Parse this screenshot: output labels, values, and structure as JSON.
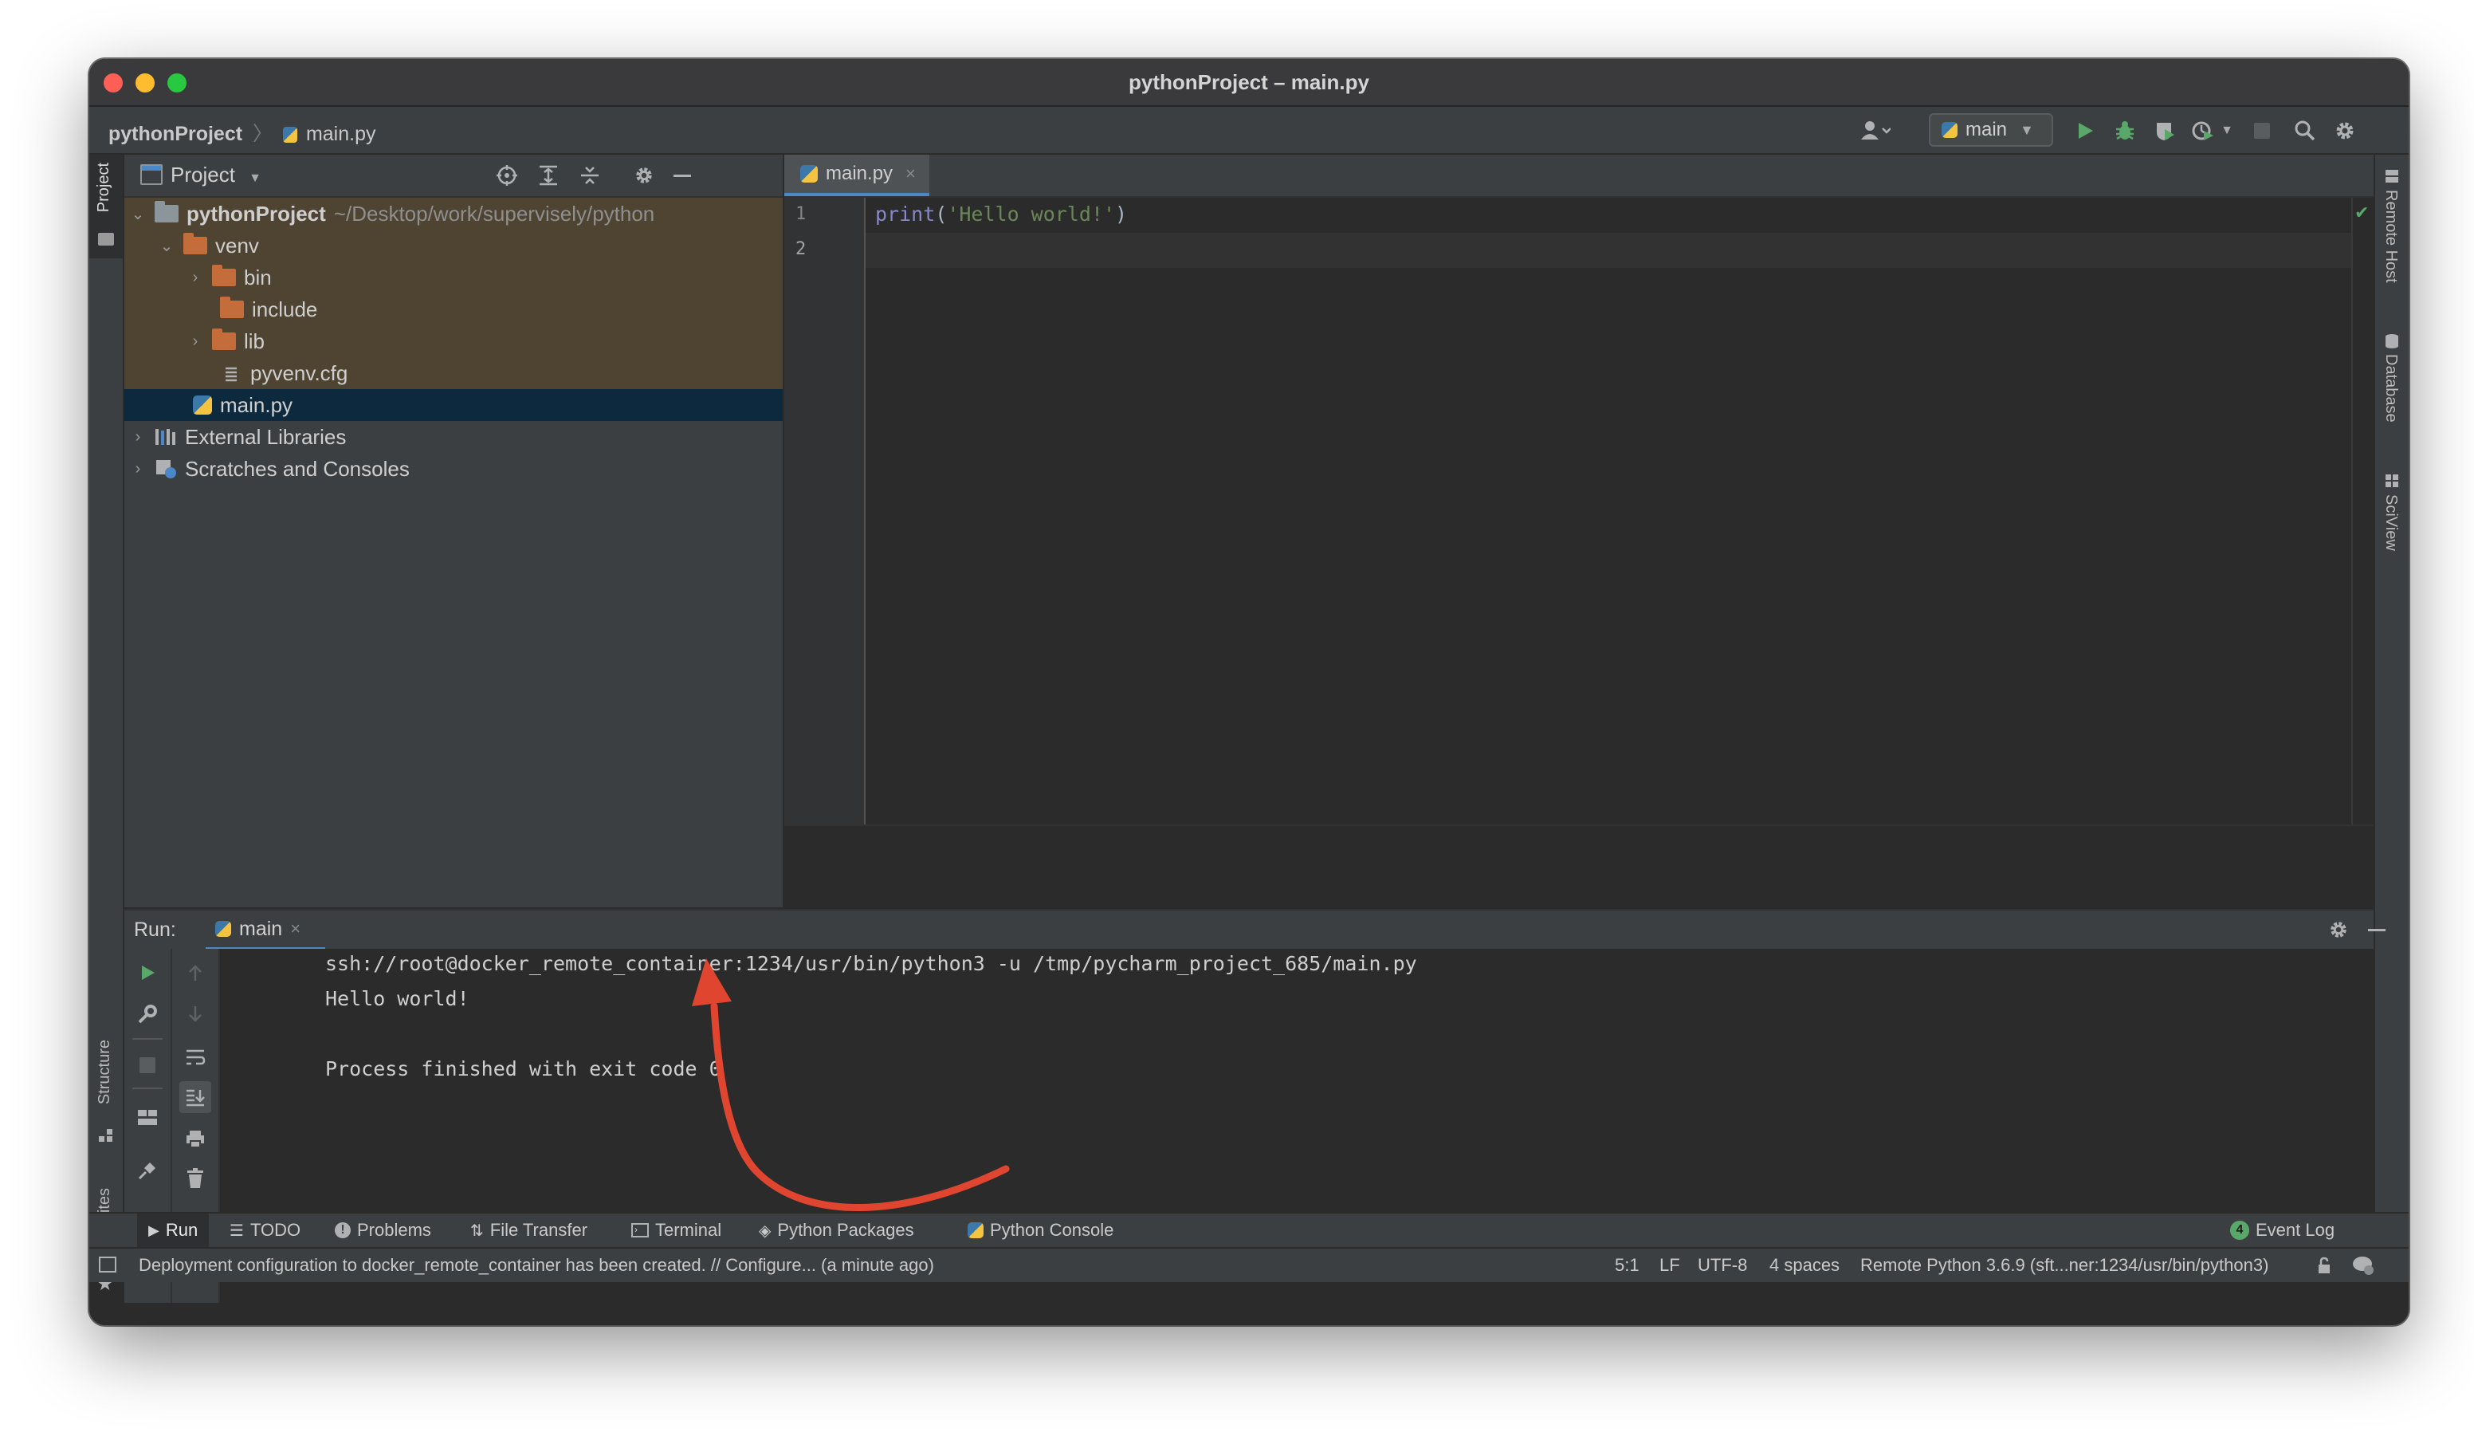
{
  "window": {
    "title": "pythonProject – main.py"
  },
  "navbar": {
    "project": "pythonProject",
    "file": "main.py",
    "run_config": "main"
  },
  "left_stripe": {
    "project": "Project",
    "structure": "Structure",
    "favorites": "Favorites"
  },
  "right_stripe": {
    "remote_host": "Remote Host",
    "database": "Database",
    "sciview": "SciView"
  },
  "project_panel": {
    "title": "Project",
    "root": {
      "name": "pythonProject",
      "path": "~/Desktop/work/supervisely/python"
    },
    "venv": "venv",
    "items": {
      "bin": "bin",
      "include": "include",
      "lib": "lib",
      "cfg": "pyvenv.cfg"
    },
    "main": "main.py",
    "external": "External Libraries",
    "scratches": "Scratches and Consoles"
  },
  "editor": {
    "tab": "main.py",
    "lines": [
      "1",
      "2"
    ],
    "code": {
      "fn": "print",
      "open": "(",
      "str": "'Hello world!'",
      "close": ")"
    }
  },
  "run": {
    "label": "Run:",
    "tab": "main",
    "output": [
      "ssh://root@docker_remote_container:1234/usr/bin/python3 -u /tmp/pycharm_project_685/main.py",
      "Hello world!",
      "",
      "Process finished with exit code 0"
    ]
  },
  "tool_windows": [
    "Run",
    "TODO",
    "Problems",
    "File Transfer",
    "Terminal",
    "Python Packages",
    "Python Console"
  ],
  "event_log": {
    "count": "4",
    "label": "Event Log"
  },
  "status": {
    "message": "Deployment configuration to docker_remote_container has been created. // Configure... (a minute ago)",
    "position": "5:1",
    "line_sep": "LF",
    "encoding": "UTF-8",
    "indent": "4 spaces",
    "interpreter": "Remote Python 3.6.9 (sft...ner:1234/usr/bin/python3)"
  },
  "colors": {
    "keyword": "#8888c6",
    "string": "#6a8759",
    "accent_blue": "#4a88c7",
    "run_green": "#59a869",
    "arrow_red": "#e0452f"
  }
}
